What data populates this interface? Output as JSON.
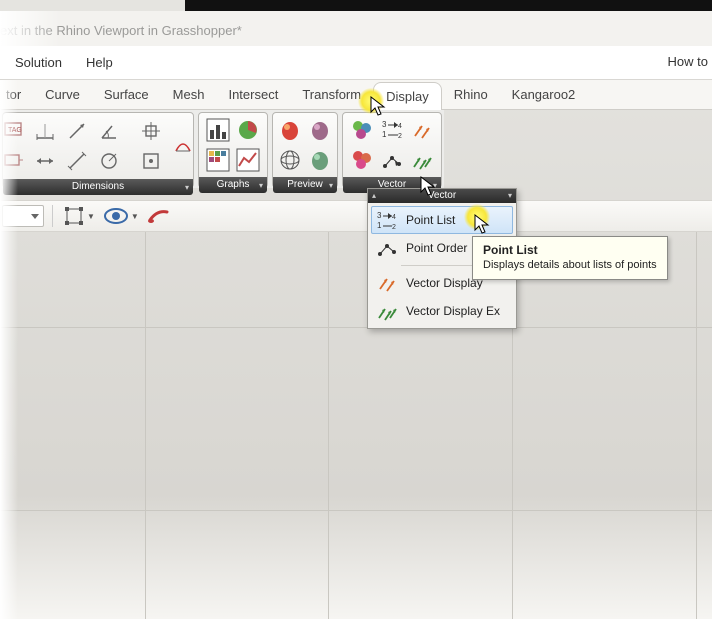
{
  "title": "ext in the Rhino Viewport in Grasshopper*",
  "menu": {
    "solution": "Solution",
    "help": "Help",
    "howto": "How to"
  },
  "tabs": {
    "t0": "tor",
    "t1": "Curve",
    "t2": "Surface",
    "t3": "Mesh",
    "t4": "Intersect",
    "t5": "Transform",
    "t6": "Display",
    "t7": "Rhino",
    "t8": "Kangaroo2"
  },
  "panels": {
    "dimensions": "Dimensions",
    "graphs": "Graphs",
    "preview": "Preview",
    "vector": "Vector"
  },
  "dropdown": {
    "header": "Vector",
    "point_list": "Point List",
    "point_order": "Point Order",
    "vector_display": "Vector Display",
    "vector_display_ex": "Vector Display Ex"
  },
  "tooltip": {
    "title": "Point List",
    "body": "Displays details about lists of points"
  }
}
